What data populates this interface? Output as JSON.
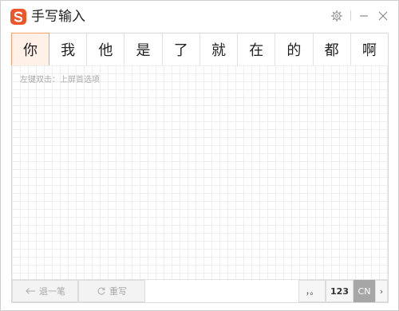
{
  "window": {
    "title": "手写输入",
    "brand_color": "#f0552a"
  },
  "titlebar": {
    "settings_icon": "gear-icon",
    "minimize_icon": "minimize-icon",
    "close_icon": "close-icon"
  },
  "candidates": [
    "你",
    "我",
    "他",
    "是",
    "了",
    "就",
    "在",
    "的",
    "都",
    "啊"
  ],
  "selected_candidate_index": 0,
  "pad": {
    "hint": "左键双击：上屏首选项"
  },
  "toolbar": {
    "undo_label": "退一笔",
    "rewrite_label": "重写",
    "punct_label": "，。",
    "number_label": "123",
    "cn_label": "CN",
    "next_label": "›"
  },
  "colors": {
    "selected_bg": "#fff1e8",
    "selected_border": "#f3a071",
    "cn_active_bg": "#a6a6a6"
  }
}
